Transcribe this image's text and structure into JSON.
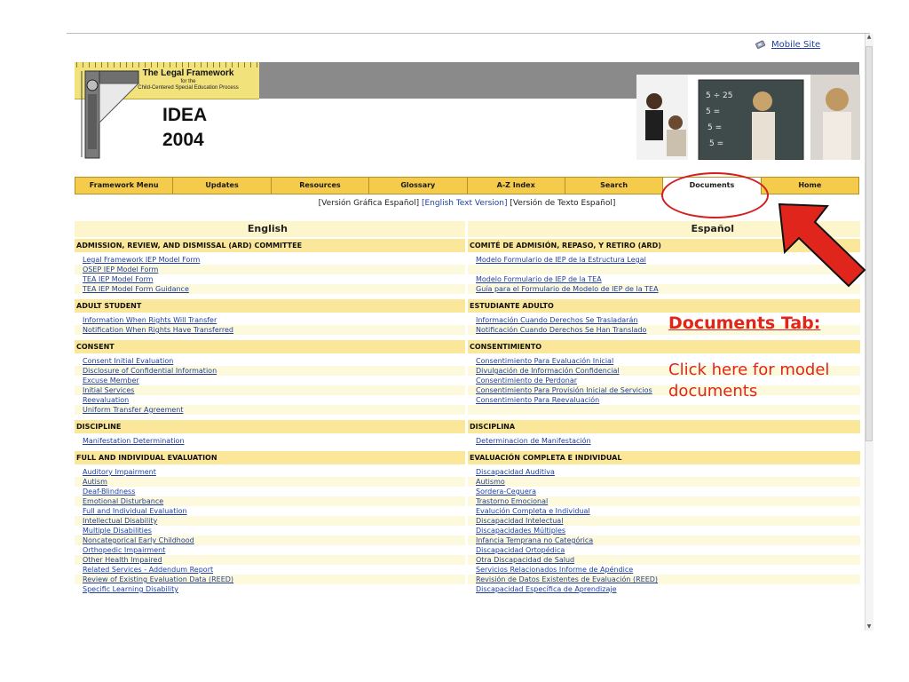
{
  "top_link": {
    "label": "Mobile Site",
    "icon": "mobile-phone-icon"
  },
  "logo": {
    "title": "The Legal Framework",
    "for": "for the",
    "subtitle": "Child-Centered Special Education Process",
    "idea": "IDEA",
    "year": "2004"
  },
  "tabs": [
    {
      "label": "Framework Menu"
    },
    {
      "label": "Updates"
    },
    {
      "label": "Resources"
    },
    {
      "label": "Glossary"
    },
    {
      "label": "A-Z Index"
    },
    {
      "label": "Search"
    },
    {
      "label": "Documents"
    },
    {
      "label": "Home"
    }
  ],
  "version_links": {
    "graphic_es": "[Versión Gráfica Español]",
    "text_en": "[English Text Version]",
    "text_es": "[Versión de Texto Español]"
  },
  "english": {
    "heading": "English",
    "sections": [
      {
        "title": "ADMISSION, REVIEW, AND DISMISSAL (ARD) COMMITTEE",
        "items": [
          "Legal Framework IEP Model Form",
          "OSEP IEP Model Form",
          "TEA IEP Model Form",
          "TEA IEP Model Form Guidance"
        ]
      },
      {
        "title": "ADULT STUDENT",
        "items": [
          "Information When Rights Will Transfer",
          "Notification When Rights Have Transferred"
        ]
      },
      {
        "title": "CONSENT",
        "items": [
          "Consent Initial Evaluation",
          "Disclosure of Confidential Information",
          "Excuse Member",
          "Initial Services",
          "Reevaluation",
          "Uniform Transfer Agreement"
        ]
      },
      {
        "title": "DISCIPLINE",
        "items": [
          "Manifestation Determination"
        ]
      },
      {
        "title": "FULL AND INDIVIDUAL EVALUATION",
        "items": [
          "Auditory Impairment",
          "Autism",
          "Deaf-Blindness",
          "Emotional Disturbance",
          "Full and Individual Evaluation",
          "Intellectual Disability",
          "Multiple Disabilities",
          "Noncategorical Early Childhood",
          "Orthopedic Impairment",
          "Other Health Impaired",
          "Related Services - Addendum Report",
          "Review of Existing Evaluation Data (REED)",
          "Specific Learning Disability"
        ]
      }
    ]
  },
  "spanish": {
    "heading": "Español",
    "sections": [
      {
        "title": "COMITÉ DE ADMISIÓN, REPASO, Y RETIRO (ARD)",
        "items": [
          "Modelo Formulario de IEP de la Estructura Legal",
          "",
          "Modelo Formulario de IEP de la TEA",
          "Guía para el Formulario de Modelo de IEP de la TEA"
        ]
      },
      {
        "title": "ESTUDIANTE ADULTO",
        "items": [
          "Información Cuando Derechos Se Trasladarán",
          "Notificación Cuando Derechos Se Han Translado"
        ]
      },
      {
        "title": "CONSENTIMIENTO",
        "items": [
          "Consentimiento Para Evaluación Inicial",
          "Divulgación de Información Confidencial",
          "Consentimiento de Perdonar",
          "Consentimiento Para Provisión Inicial de Servicios",
          "Consentimiento Para Reevaluación",
          ""
        ]
      },
      {
        "title": "DISCIPLINA",
        "items": [
          "Determinacion de Manifestación"
        ]
      },
      {
        "title": "EVALUACIÓN COMPLETA E INDIVIDUAL",
        "items": [
          "Discapacidad Auditiva",
          "Autismo",
          "Sordera-Ceguera",
          "Trastorno Emocional",
          "Evalución Completa e Individual",
          "Discapacidad Intelectual",
          "Discapacidades Múltiples",
          "Infancia Temprana no Categórica",
          "Discapacidad Ortopédica",
          "Otra Discapacidad de Salud",
          "Servicios Relacionados Informe de Apéndice",
          "Revisión de Datos Existentes de Evaluación (REED)",
          "Discapacidad Específica de Aprendizaje"
        ]
      }
    ]
  },
  "annotation": {
    "title": "Documents Tab:",
    "body": "Click here for model documents",
    "color": "#e0261c"
  },
  "colors": {
    "tab_bg": "#f5cb4b",
    "section_bg": "#fbe79a",
    "link": "#1f3f9f"
  }
}
